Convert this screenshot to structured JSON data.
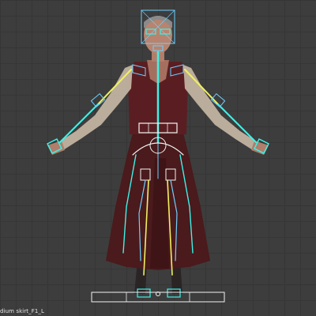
{
  "viewport": {
    "status_text": "dium skirt_F1_L"
  },
  "colors": {
    "background": "#3d3d3d",
    "grid": "#363636",
    "skirt": "#4a1a1c",
    "sleeve": "#c9b9a6",
    "skin": "#b07e6a",
    "bone_selected": "#3df2e8",
    "bone_active": "#f0f060",
    "rig_outline": "#6fd0ff"
  },
  "icons": [
    "character-mesh",
    "armature-rig",
    "head-control-box",
    "ground-control-bar"
  ]
}
